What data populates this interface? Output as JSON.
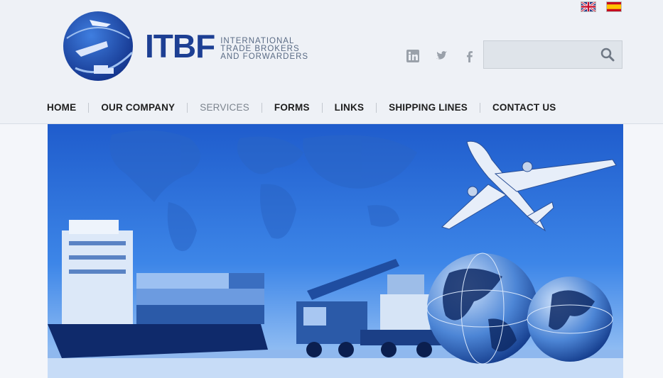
{
  "brand": {
    "acronym": "ITBF",
    "tagline_lines": [
      "International",
      "Trade Brokers",
      "and Forwarders"
    ]
  },
  "languages": [
    {
      "code": "en",
      "icon": "uk-flag-icon"
    },
    {
      "code": "es",
      "icon": "spain-flag-icon"
    }
  ],
  "social": [
    "linkedin-icon",
    "twitter-icon",
    "facebook-icon"
  ],
  "search": {
    "placeholder": "",
    "value": ""
  },
  "nav": {
    "items": [
      {
        "label": "HOME",
        "active": false
      },
      {
        "label": "OUR COMPANY",
        "active": false
      },
      {
        "label": "SERVICES",
        "active": true
      },
      {
        "label": "FORMS",
        "active": false
      },
      {
        "label": "LINKS",
        "active": false
      },
      {
        "label": "SHIPPING LINES",
        "active": false
      },
      {
        "label": "CONTACT US",
        "active": false
      }
    ]
  },
  "colors": {
    "brand": "#1d3f93",
    "hero_sky": "#2f6fd6",
    "header_bg": "#eef1f6"
  }
}
